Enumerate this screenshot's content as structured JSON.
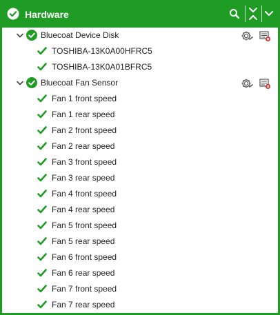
{
  "header": {
    "title": "Hardware",
    "status_icon": "ok-circle-icon",
    "search_icon": "search-icon",
    "collapse_all_icon": "collapse-all-icon",
    "menu_icon": "chevron-down-icon"
  },
  "colors": {
    "frame": "#1f9c24",
    "ok": "#1f9c24",
    "text": "#222222"
  },
  "groups": [
    {
      "label": "Bluecoat Device Disk",
      "status": "ok",
      "expanded": true,
      "children": [
        {
          "label": "TOSHIBA-13K0A00HFRC5",
          "status": "ok"
        },
        {
          "label": "TOSHIBA-13K0A01BFRC5",
          "status": "ok"
        }
      ]
    },
    {
      "label": "Bluecoat Fan Sensor",
      "status": "ok",
      "expanded": true,
      "children": [
        {
          "label": "Fan 1 front speed",
          "status": "ok"
        },
        {
          "label": "Fan 1 rear speed",
          "status": "ok"
        },
        {
          "label": "Fan 2 front speed",
          "status": "ok"
        },
        {
          "label": "Fan 2 rear speed",
          "status": "ok"
        },
        {
          "label": "Fan 3 front speed",
          "status": "ok"
        },
        {
          "label": "Fan 3 rear speed",
          "status": "ok"
        },
        {
          "label": "Fan 4 front speed",
          "status": "ok"
        },
        {
          "label": "Fan 4 rear speed",
          "status": "ok"
        },
        {
          "label": "Fan 5 front speed",
          "status": "ok"
        },
        {
          "label": "Fan 5 rear speed",
          "status": "ok"
        },
        {
          "label": "Fan 6 front speed",
          "status": "ok"
        },
        {
          "label": "Fan 6 rear speed",
          "status": "ok"
        },
        {
          "label": "Fan 7 front speed",
          "status": "ok"
        },
        {
          "label": "Fan 7 rear speed",
          "status": "ok"
        }
      ]
    }
  ]
}
